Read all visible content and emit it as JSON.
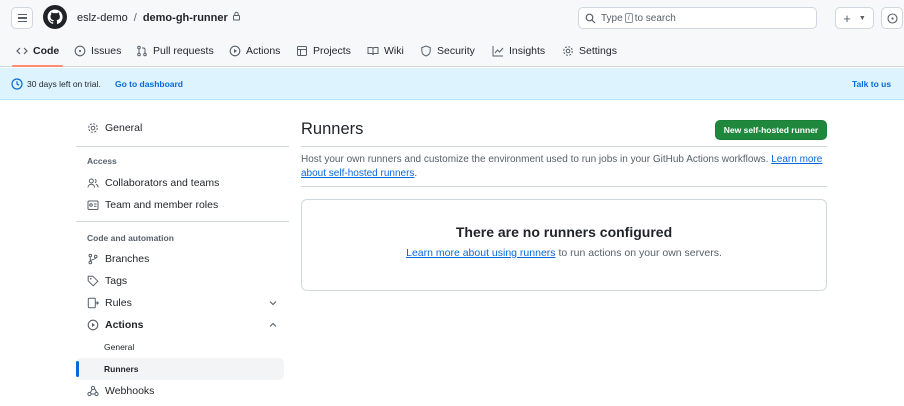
{
  "header": {
    "owner": "eslz-demo",
    "separator": "/",
    "repo_name": "demo-gh-runner",
    "search_prefix": "Type",
    "search_key": "/",
    "search_suffix": "to search",
    "plus_label": "+"
  },
  "repo_nav": [
    {
      "label": "Code",
      "icon": "code-icon",
      "active": true
    },
    {
      "label": "Issues",
      "icon": "issue-icon"
    },
    {
      "label": "Pull requests",
      "icon": "pull-request-icon"
    },
    {
      "label": "Actions",
      "icon": "play-icon"
    },
    {
      "label": "Projects",
      "icon": "table-icon"
    },
    {
      "label": "Wiki",
      "icon": "book-icon"
    },
    {
      "label": "Security",
      "icon": "shield-icon"
    },
    {
      "label": "Insights",
      "icon": "graph-icon"
    },
    {
      "label": "Settings",
      "icon": "gear-icon"
    }
  ],
  "banner": {
    "trial_text": "30 days left on trial.",
    "dashboard_link": "Go to dashboard",
    "talk_link": "Talk to us"
  },
  "sidebar": {
    "general": "General",
    "access_heading": "Access",
    "collaborators": "Collaborators and teams",
    "team_roles": "Team and member roles",
    "code_heading": "Code and automation",
    "branches": "Branches",
    "tags": "Tags",
    "rules": "Rules",
    "actions": "Actions",
    "actions_general": "General",
    "actions_runners": "Runners",
    "webhooks": "Webhooks"
  },
  "main": {
    "title": "Runners",
    "new_runner_button": "New self-hosted runner",
    "description": "Host your own runners and customize the environment used to run jobs in your GitHub Actions workflows.",
    "description_link": "Learn more about self-hosted runners",
    "empty_title": "There are no runners configured",
    "empty_link": "Learn more about using runners",
    "empty_suffix": "to run actions on your own servers."
  },
  "colors": {
    "accent": "#0969da",
    "primary_button": "#1f883d",
    "active_tab_underline": "#fd8c73",
    "banner_bg": "#ddf4ff"
  }
}
